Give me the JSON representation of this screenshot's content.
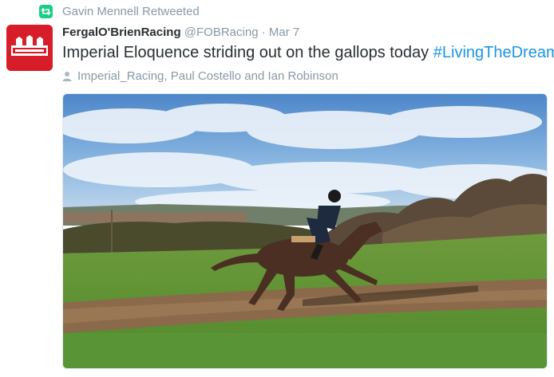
{
  "retweet_context": {
    "icon": "retweet-icon",
    "text": "Gavin Mennell Retweeted",
    "icon_color": "#19cf86"
  },
  "tweet": {
    "avatar_icon": "racing-logo-icon",
    "avatar_color": "#d71d29",
    "display_name": "FergalO'BrienRacing",
    "handle": "@FOBRacing",
    "separator": "·",
    "timestamp": "Mar 7",
    "text": "Imperial Eloquence striding out on the gallops today",
    "hashtag": "#LivingTheDream",
    "hashtag_color": "#1b95e0",
    "tagged_icon": "person-icon",
    "tagged": "Imperial_Racing, Paul Costello and Ian Robinson",
    "media": "photo of a jockey riding a bay racehorse on a grass gallop under a blue sky"
  }
}
